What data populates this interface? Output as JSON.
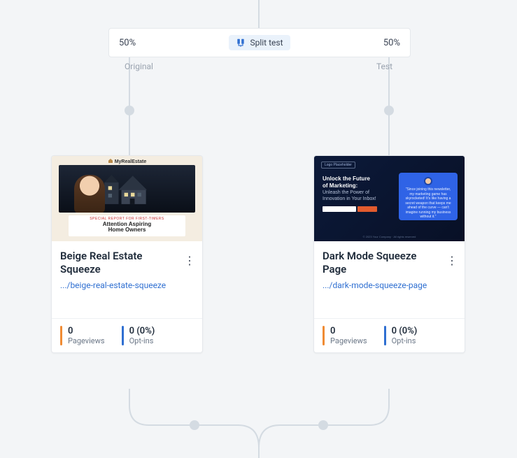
{
  "split": {
    "left_pct": "50%",
    "right_pct": "50%",
    "label": "Split test",
    "variant_a_label": "Original",
    "variant_b_label": "Test"
  },
  "cards": {
    "a": {
      "title": "Beige Real Estate Squeeze",
      "url": ".../beige-real-estate-squeeze",
      "pageviews_value": "0",
      "pageviews_label": "Pageviews",
      "optins_value": "0 (0%)",
      "optins_label": "Opt-ins",
      "thumb": {
        "brand": "MyRealEstate",
        "ribbon_small": "SPECIAL REPORT FOR FIRST-TIMERS",
        "ribbon_big1": "Attention Aspiring",
        "ribbon_big2": "Home Owners"
      }
    },
    "b": {
      "title": "Dark Mode Squeeze Page",
      "url": ".../dark-mode-squeeze-page",
      "pageviews_value": "0",
      "pageviews_label": "Pageviews",
      "optins_value": "0 (0%)",
      "optins_label": "Opt-ins",
      "thumb": {
        "logo": "Logo Placeholder",
        "headline1": "Unlock the Future",
        "headline2": "of Marketing:",
        "sub": "Unleash the Power of Innovation in Your Inbox!",
        "quote": "\"Since joining this newsletter, my marketing game has skyrocketed! It's like having a secret weapon that keeps me ahead of the curve — can't imagine running my business without it.\"",
        "footer": "© 2023 Your Company · All rights reserved"
      }
    }
  }
}
